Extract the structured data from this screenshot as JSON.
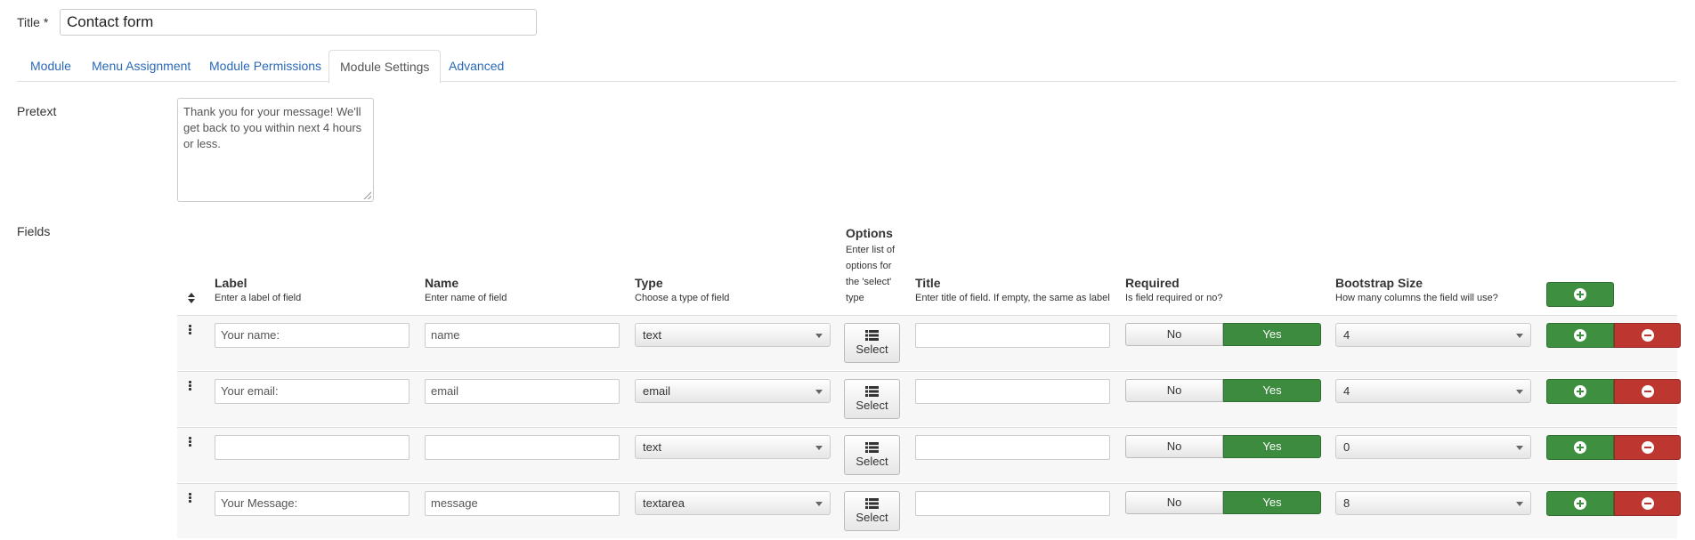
{
  "title_field": {
    "label": "Title *",
    "value": "Contact form"
  },
  "tabs": [
    {
      "label": "Module"
    },
    {
      "label": "Menu Assignment"
    },
    {
      "label": "Module Permissions"
    },
    {
      "label": "Module Settings"
    },
    {
      "label": "Advanced"
    }
  ],
  "active_tab": "Module Settings",
  "pretext": {
    "label": "Pretext",
    "value": "Thank you for your message! We'll get back to you within next 4 hours or less."
  },
  "fields": {
    "label": "Fields",
    "columns": {
      "label": {
        "title": "Label",
        "hint": "Enter a label of field"
      },
      "name": {
        "title": "Name",
        "hint": "Enter name of field"
      },
      "type": {
        "title": "Type",
        "hint": "Choose a type of field"
      },
      "options": {
        "title": "Options",
        "hint": "Enter list of options for the 'select' type",
        "hint_lines": [
          "Enter list of",
          "options for",
          "the 'select'",
          "type"
        ]
      },
      "title": {
        "title": "Title",
        "hint": "Enter title of field. If empty, the same as label"
      },
      "required": {
        "title": "Required",
        "hint": "Is field required or no?"
      },
      "bootstrap": {
        "title": "Bootstrap Size",
        "hint": "How many columns the field will use?"
      }
    },
    "select_button_label": "Select",
    "toggle": {
      "no": "No",
      "yes": "Yes"
    },
    "rows": [
      {
        "label": "Your name:",
        "name": "name",
        "type": "text",
        "title": "",
        "required": "Yes",
        "bootstrap": "4"
      },
      {
        "label": "Your email:",
        "name": "email",
        "type": "email",
        "title": "",
        "required": "Yes",
        "bootstrap": "4"
      },
      {
        "label": "",
        "name": "",
        "type": "text",
        "title": "",
        "required": "Yes",
        "bootstrap": "0"
      },
      {
        "label": "Your Message:",
        "name": "message",
        "type": "textarea",
        "title": "",
        "required": "Yes",
        "bootstrap": "8"
      }
    ]
  },
  "colors": {
    "link": "#2a69b8",
    "add_green": "#3e8f40",
    "remove_red": "#bd362f",
    "yes_green": "#3c8b3e"
  },
  "icons": {
    "sort": "sort-icon",
    "handle": "drag-handle-icon",
    "list": "list-icon",
    "add": "plus-circle-icon",
    "remove": "minus-circle-icon"
  }
}
